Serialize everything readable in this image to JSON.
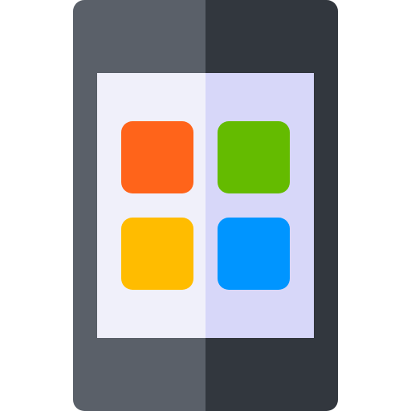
{
  "icon": {
    "name": "tablet-apps-icon",
    "colors": {
      "device_left": "#5A6069",
      "device_right": "#32373E",
      "screen_left": "#F0F0FA",
      "screen_right": "#D7D7F9"
    },
    "tiles": [
      {
        "name": "orange-app-tile",
        "color": "#FF641A"
      },
      {
        "name": "green-app-tile",
        "color": "#64BB00"
      },
      {
        "name": "yellow-app-tile",
        "color": "#FFBC00"
      },
      {
        "name": "blue-app-tile",
        "color": "#0095FF"
      }
    ]
  }
}
